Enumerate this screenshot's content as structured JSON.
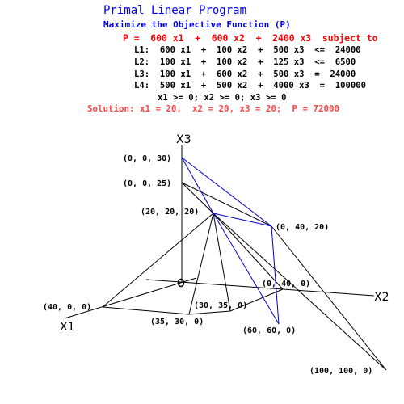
{
  "header": {
    "title": "Primal Linear Program",
    "subtitle": "Maximize the Objective Function (P)",
    "objective": "P =  600 x1  +  600 x2  +  2400 x3  subject to",
    "constraints": [
      "L1:  600 x1  +  100 x2  +  500 x3  <=  24000",
      "L2:  100 x1  +  100 x2  +  125 x3  <=  6500",
      "L3:  100 x1  +  600 x2  +  500 x3  =  24000",
      "L4:  500 x1  +  500 x2  +  4000 x3  =  100000"
    ],
    "nonnegativity": "x1 >= 0; x2 >= 0; x3 >= 0",
    "solution": "Solution: x1 = 20,  x2 = 20, x3 = 20;  P = 72000"
  },
  "colors": {
    "title": "#0000ee",
    "objective": "#ff0000",
    "solution": "#ff4545",
    "feasible_edges": "#0000cc",
    "plane_edges": "#000000"
  },
  "diagram": {
    "axes": {
      "x1": "X1",
      "x2": "X2",
      "x3": "X3",
      "origin": "0"
    },
    "points": {
      "p0_0_30": "(0, 0, 30)",
      "p0_0_25": "(0, 0, 25)",
      "p20_20_20": "(20, 20, 20)",
      "p0_40_20": "(0, 40, 20)",
      "p0_40_0": "(0, 40, 0)",
      "p40_0_0": "(40, 0, 0)",
      "p30_35_0": "(30, 35, 0)",
      "p35_30_0": "(35, 30, 0)",
      "p60_60_0": "(60, 60, 0)",
      "p100_100_0": "(100, 100, 0)"
    }
  }
}
